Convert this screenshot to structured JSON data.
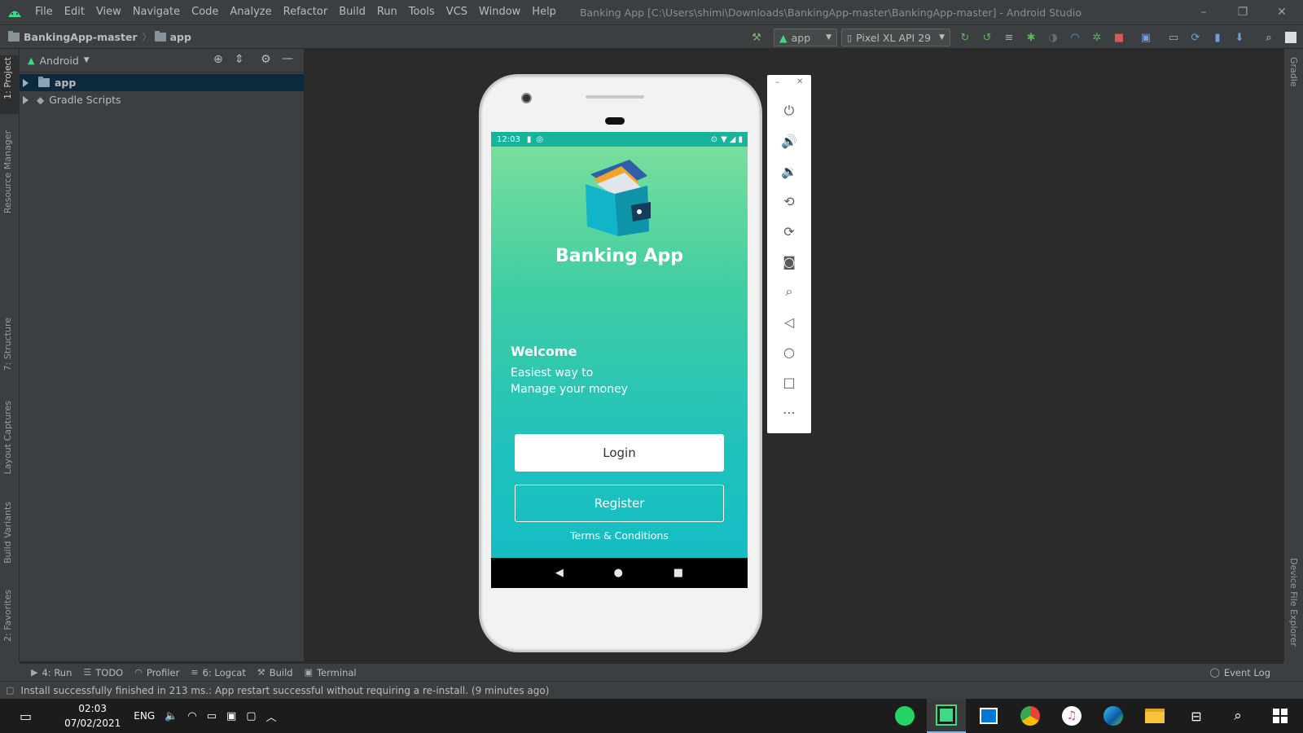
{
  "window": {
    "title": "Banking App [C:\\Users\\shimi\\Downloads\\BankingApp-master\\BankingApp-master] - Android Studio",
    "menu": [
      "File",
      "Edit",
      "View",
      "Navigate",
      "Code",
      "Analyze",
      "Refactor",
      "Build",
      "Run",
      "Tools",
      "VCS",
      "Window",
      "Help"
    ]
  },
  "navbar": {
    "breadcrumb": [
      "BankingApp-master",
      "app"
    ],
    "run_config": "app",
    "device": "Pixel XL API 29"
  },
  "left_tool_tabs": [
    "1: Project",
    "Resource Manager",
    "7: Structure",
    "Layout Captures",
    "Build Variants",
    "2: Favorites"
  ],
  "right_tool_tabs": [
    "Gradle",
    "Device File Explorer"
  ],
  "project": {
    "view_mode": "Android",
    "tree": [
      {
        "label": "app",
        "selected": true
      },
      {
        "label": "Gradle Scripts",
        "selected": false
      }
    ]
  },
  "phone": {
    "status_time": "12:03",
    "app_title": "Banking App",
    "welcome": "Welcome",
    "tagline_line1": "Easiest way to",
    "tagline_line2": "Manage your money",
    "login_label": "Login",
    "register_label": "Register",
    "terms_label": "Terms & Conditions"
  },
  "emulator_controls": [
    "power-icon",
    "volume-up-icon",
    "volume-down-icon",
    "rotate-left-icon",
    "rotate-right-icon",
    "camera-icon",
    "zoom-icon",
    "back-icon",
    "home-icon",
    "overview-icon",
    "more-icon"
  ],
  "bottom_tabs": [
    {
      "icon": "run-icon",
      "label": "4: Run"
    },
    {
      "icon": "todo-icon",
      "label": "TODO"
    },
    {
      "icon": "profiler-icon",
      "label": "Profiler"
    },
    {
      "icon": "logcat-icon",
      "label": "6: Logcat"
    },
    {
      "icon": "build-icon",
      "label": "Build"
    },
    {
      "icon": "terminal-icon",
      "label": "Terminal"
    }
  ],
  "event_log_label": "Event Log",
  "status_message": "Install successfully finished in 213 ms.: App restart successful without requiring a re-install. (9 minutes ago)",
  "taskbar": {
    "time": "02:03",
    "date": "07/02/2021",
    "language": "ENG"
  },
  "colors": {
    "ide_bg": "#2b2b2b",
    "panel_bg": "#3c3f41",
    "selection": "#0d293e",
    "app_gradient_top": "#7fe09c",
    "app_gradient_bottom": "#12bcc4",
    "taskbar": "#1c1c1c"
  }
}
